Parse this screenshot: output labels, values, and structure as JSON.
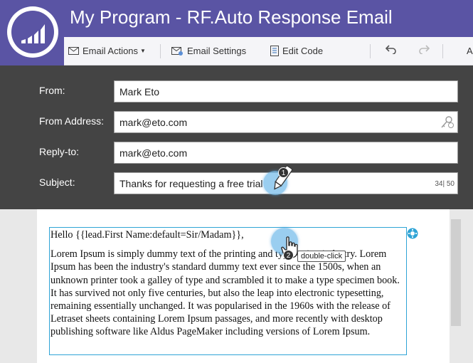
{
  "header": {
    "title": "My Program - RF.Auto Response Email",
    "logo_icon": "marketo-logo-icon"
  },
  "toolbar": {
    "email_actions_label": "Email Actions",
    "email_settings_label": "Email Settings",
    "edit_code_label": "Edit Code",
    "trailing_label": "A"
  },
  "form": {
    "from_label": "From:",
    "from_value": "Mark Eto",
    "from_address_label": "From Address:",
    "from_address_value": "mark@eto.com",
    "reply_to_label": "Reply-to:",
    "reply_to_value": "mark@eto.com",
    "subject_label": "Subject:",
    "subject_value": "Thanks for requesting a free trial",
    "subject_counter": "34| 50"
  },
  "editor": {
    "greeting": "Hello {{lead.First Name:default=Sir/Madam}},",
    "body": "Lorem Ipsum is simply dummy text of the printing and typesetting industry. Lorem Ipsum has been the industry's standard dummy text ever since the 1500s, when an unknown printer took a galley of type and scrambled it to make a type specimen book. It has survived not only five centuries, but also the leap into electronic typesetting, remaining essentially unchanged. It was popularised in the 1960s with the release of Letraset sheets containing Lorem Ipsum passages, and more recently with desktop publishing software like Aldus PageMaker including versions of Lorem Ipsum."
  },
  "annotations": {
    "step1_number": "1",
    "step2_number": "2",
    "step2_tooltip": "double-click"
  },
  "colors": {
    "header_bg": "#5a54a4",
    "form_bg": "#444444",
    "selection_border": "#2fa4d6"
  }
}
